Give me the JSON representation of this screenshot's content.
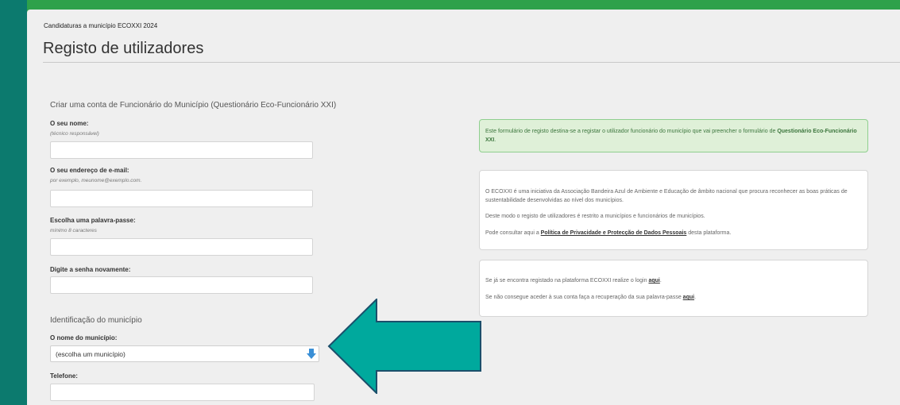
{
  "breadcrumb": "Candidaturas a município ECOXXI 2024",
  "page_title": "Registo de utilizadores",
  "account_section": {
    "title": "Criar uma conta de Funcionário do Município (Questionário Eco-Funcionário XXI)",
    "name": {
      "label": "O seu nome:",
      "hint": "(técnico responsável)",
      "value": ""
    },
    "email": {
      "label": "O seu endereço de e-mail:",
      "hint": "por exemplo, meunome@exemplo.com.",
      "value": ""
    },
    "password": {
      "label": "Escolha uma palavra-passe:",
      "hint": "mínimo 8 caracteres",
      "value": ""
    },
    "password_confirm": {
      "label": "Digite a senha novamente:",
      "value": ""
    }
  },
  "municipality_section": {
    "title": "Identificação do município",
    "municipality": {
      "label": "O nome do município:",
      "selected": "(escolha um município)"
    },
    "phone": {
      "label": "Telefone:",
      "value": ""
    }
  },
  "info_panel": {
    "text_before": "Este formulário de registo destina-se a registar o utilizador funcionário do município que vai preencher o formulário de ",
    "strong": "Questionário Eco-Funcionário XXI",
    "text_after": "."
  },
  "about_panel": {
    "p1": "O ECOXXI é uma iniciativa da Associação Bandeira Azul de Ambiente e Educação de âmbito nacional que procura reconhecer as boas práticas de sustentabilidade desenvolvidas ao nível dos municípios.",
    "p2": "Deste modo o registo de utilizadores é restrito a municípios e funcionários de municípios.",
    "p3_before": "Pode consultar aqui a ",
    "p3_link": "Política de Privacidade e Protecção de Dados Pessoais",
    "p3_after": " desta plataforma."
  },
  "login_panel": {
    "p1_before": "Se já se encontra registado na plataforma ECOXXI realize o login ",
    "p1_link": "aqui",
    "p1_after": ".",
    "p2_before": "Se não consegue aceder à sua conta faça a recuperação da sua palavra-passe ",
    "p2_link": "aqui",
    "p2_after": "."
  },
  "colors": {
    "header_green": "#2ea14b",
    "frame_teal": "#0c7a6e",
    "arrow_teal": "#00a99d",
    "info_bg": "#dff0d8"
  },
  "icons": {
    "select_arrow": "arrow-down-icon",
    "annotation": "left-arrow-icon"
  }
}
